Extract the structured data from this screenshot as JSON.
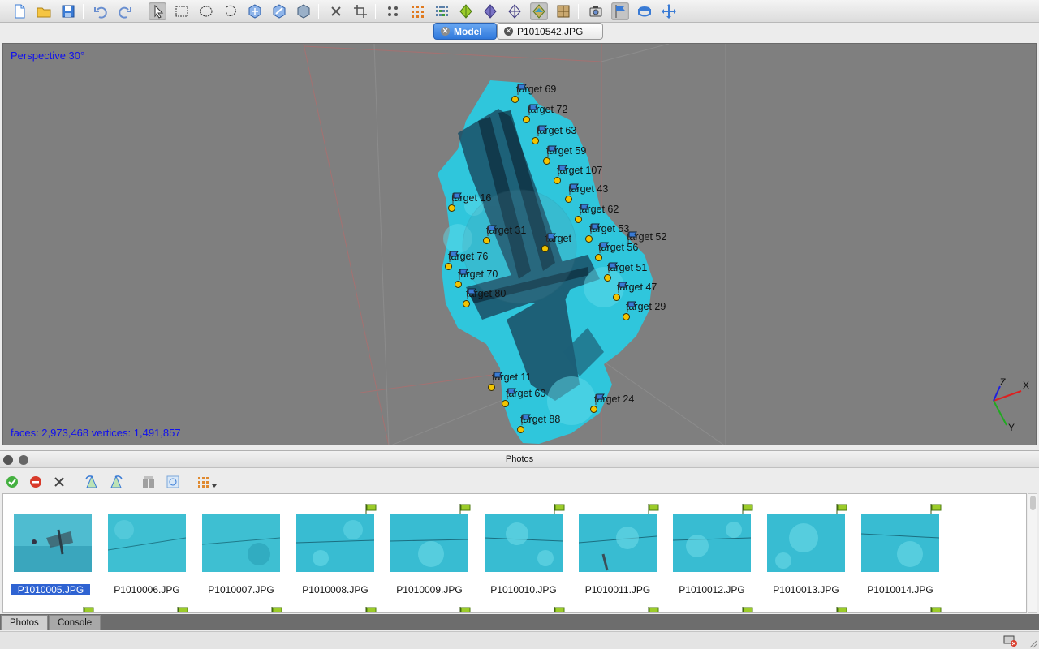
{
  "toolbar": {
    "icons": [
      "new-document-icon",
      "open-folder-icon",
      "save-icon",
      "undo-icon",
      "redo-icon",
      "navigation-pointer-icon",
      "rectangle-selection-icon",
      "circle-selection-icon",
      "free-form-selection-icon",
      "resize-region-icon",
      "rotate-region-icon",
      "rotate-object-icon",
      "delete-selection-icon",
      "crop-selection-icon",
      "show-cameras-icon",
      "point-cloud-icon",
      "dense-cloud-icon",
      "shaded-model-icon",
      "solid-model-icon",
      "wireframe-model-icon",
      "textured-model-icon",
      "tiled-model-icon",
      "show-cameras-toggle-icon",
      "show-markers-icon",
      "show-region-icon",
      "reset-view-icon"
    ]
  },
  "tabs": {
    "model": "Model",
    "photo": "P1010542.JPG"
  },
  "viewport": {
    "view_label": "Perspective 30°",
    "stats": "faces: 2,973,468 vertices: 1,491,857",
    "axes": {
      "x": "X",
      "y": "Y",
      "z": "Z"
    },
    "markers": [
      "target 69",
      "target 72",
      "target 63",
      "target 59",
      "target 107",
      "target 43",
      "target 62",
      "target 53",
      "target 52",
      "target 56",
      "target 51",
      "target 47",
      "target 29",
      "target 16",
      "target 31",
      "target 76",
      "target 70",
      "target 80",
      "target 11",
      "target 60",
      "target 24",
      "target 88",
      "target"
    ]
  },
  "photos_panel": {
    "title": "Photos",
    "toolbar_icons": [
      "enable-camera-icon",
      "disable-camera-icon",
      "remove-camera-icon",
      "rotate-left-icon",
      "rotate-right-icon",
      "filter-icon",
      "reset-filter-icon",
      "view-mode-icon"
    ],
    "photos": [
      {
        "name": "P1010005.JPG",
        "selected": true
      },
      {
        "name": "P1010006.JPG",
        "selected": false
      },
      {
        "name": "P1010007.JPG",
        "selected": false
      },
      {
        "name": "P1010008.JPG",
        "selected": false
      },
      {
        "name": "P1010009.JPG",
        "selected": false
      },
      {
        "name": "P1010010.JPG",
        "selected": false
      },
      {
        "name": "P1010011.JPG",
        "selected": false
      },
      {
        "name": "P1010012.JPG",
        "selected": false
      },
      {
        "name": "P1010013.JPG",
        "selected": false
      },
      {
        "name": "P1010014.JPG",
        "selected": false
      }
    ]
  },
  "bottom_tabs": {
    "photos": "Photos",
    "console": "Console"
  },
  "colors": {
    "accent": "#2f78dc",
    "viewport_bg": "#7f7f7f",
    "model_cyan": "#2fc6dc",
    "marker_dot": "#f2c400",
    "overlay_text": "#1010ee"
  }
}
